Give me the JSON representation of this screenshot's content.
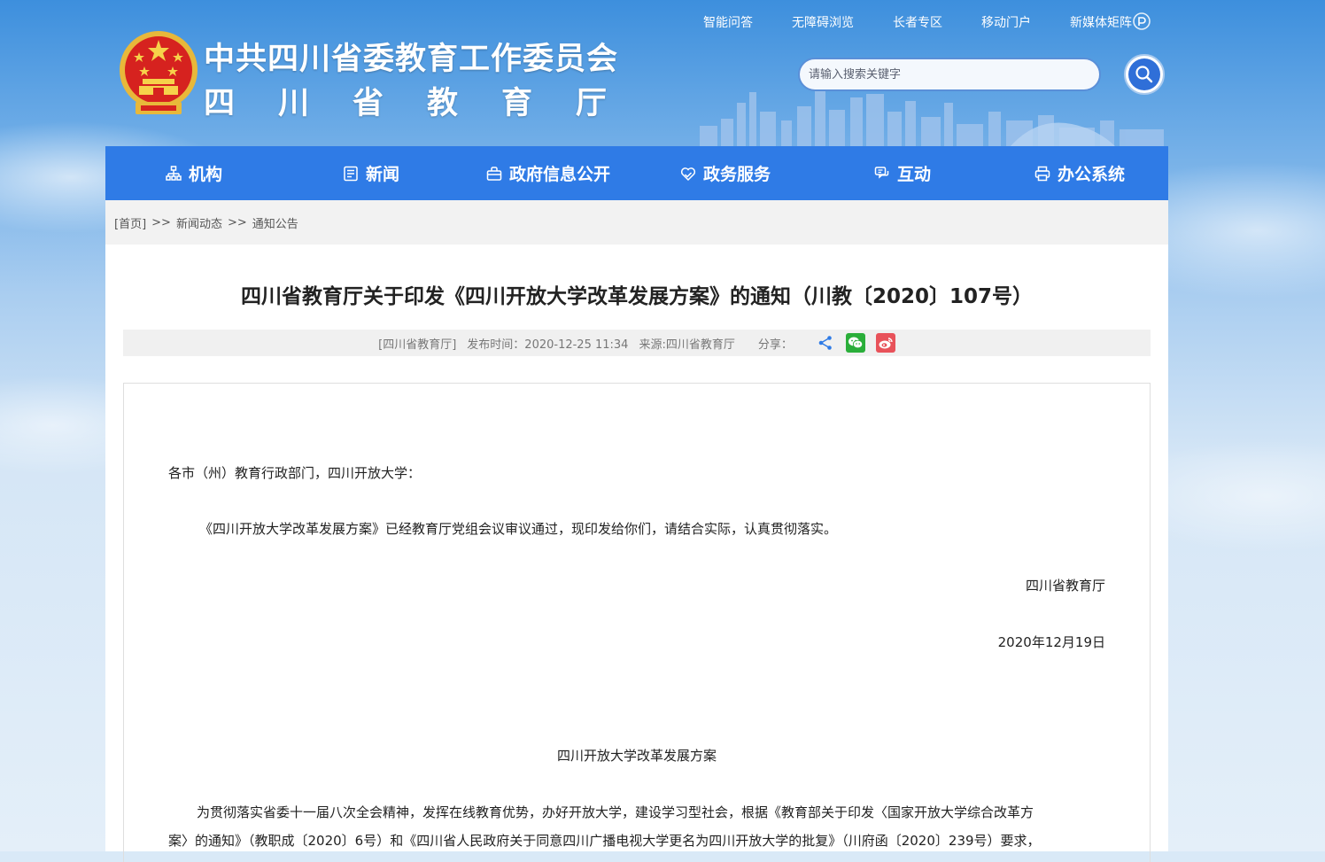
{
  "header": {
    "title_line1": "中共四川省委教育工作委员会",
    "title_line2_chars": [
      "四",
      "川",
      "省",
      "教",
      "育",
      "厅"
    ],
    "top_links": [
      "智能问答",
      "无障碍浏览",
      "长者专区",
      "移动门户",
      "新媒体矩阵"
    ],
    "search": {
      "placeholder": "请输入搜索关键字",
      "value": ""
    }
  },
  "nav": {
    "items": [
      {
        "label": "机构",
        "icon": "org-icon"
      },
      {
        "label": "新闻",
        "icon": "news-icon"
      },
      {
        "label": "政府信息公开",
        "icon": "gov-info-icon"
      },
      {
        "label": "政务服务",
        "icon": "service-icon"
      },
      {
        "label": "互动",
        "icon": "interaction-icon"
      },
      {
        "label": "办公系统",
        "icon": "office-system-icon"
      }
    ]
  },
  "breadcrumb": {
    "home": "[首页]",
    "sep": ">>",
    "level1": "新闻动态",
    "level2": "通知公告"
  },
  "article": {
    "title": "四川省教育厅关于印发《四川开放大学改革发展方案》的通知（川教〔2020〕107号）",
    "meta": {
      "publisher": "[四川省教育厅]",
      "publish_time": "发布时间：2020-12-25 11:34",
      "source": "来源:四川省教育厅",
      "share_label": "分享："
    },
    "salutation": "各市（州）教育行政部门，四川开放大学：",
    "body": "《四川开放大学改革发展方案》已经教育厅党组会议审议通过，现印发给你们，请结合实际，认真贯彻落实。",
    "signature": "四川省教育厅",
    "date": "2020年12月19日",
    "subtitle": "四川开放大学改革发展方案",
    "intro_line1": "为贯彻落实省委十一届八次全会精神，发挥在线教育优势，办好开放大学，建设学习型社会，根据《教育部关于印发〈国家开放大学综合改革方",
    "intro_line2": "案〉的通知》（教职成〔2020〕6号）和《四川省人民政府关于同意四川广播电视大学更名为四川开放大学的批复》（川府函〔2020〕239号）要求，"
  },
  "colors": {
    "nav_bg": "#2f7be6",
    "header_sky": "#3d8fdd",
    "search_border": "#5a8fd8",
    "wechat": "#2aae3a",
    "weibo": "#e8525a",
    "share": "#2f7be6"
  }
}
